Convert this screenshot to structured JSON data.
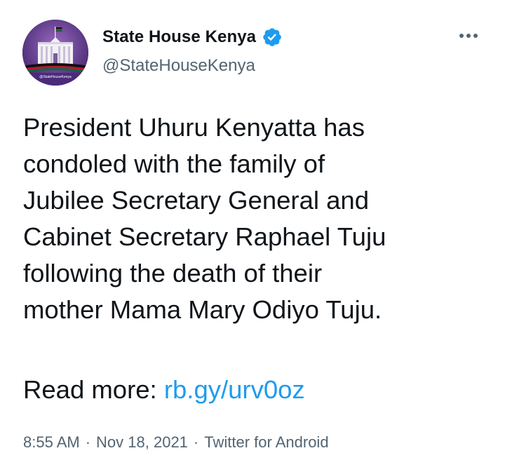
{
  "tweet": {
    "display_name": "State House Kenya",
    "handle": "@StateHouseKenya",
    "avatar_caption": "@StateHouseKenya",
    "verified_icon": "verified-badge-icon",
    "more_icon": "more-horizontal-icon",
    "text_lines": [
      "President Uhuru Kenyatta has",
      "condoled with the family of",
      "Jubilee Secretary General and",
      "Cabinet Secretary Raphael Tuju",
      "following the death of their",
      "mother Mama Mary Odiyo Tuju."
    ],
    "read_more_label": "Read more: ",
    "link_text": "rb.gy/urv0oz",
    "time": "8:55 AM",
    "date": "Nov 18, 2021",
    "source": "Twitter for Android",
    "separator": "·"
  },
  "colors": {
    "link": "#1d9bf0",
    "secondary_text": "#536471",
    "primary_text": "#0f1419",
    "verified": "#1d9bf0"
  }
}
